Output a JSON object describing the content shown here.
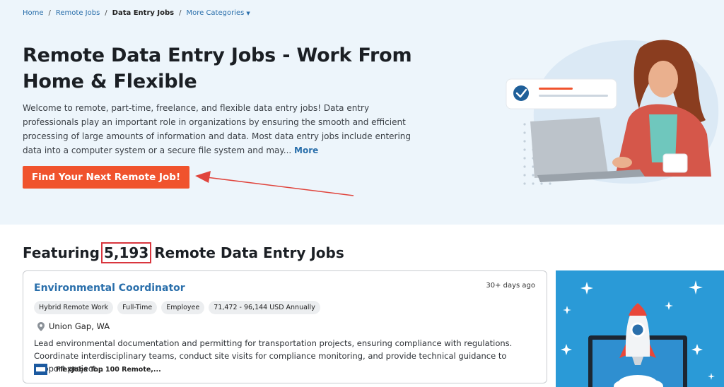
{
  "breadcrumb": {
    "home": "Home",
    "remote_jobs": "Remote Jobs",
    "current": "Data Entry Jobs",
    "more": "More Categories",
    "sep": "/"
  },
  "hero": {
    "title_line1": "Remote Data Entry Jobs - Work From",
    "title_line2": "Home & Flexible",
    "description": "Welcome to remote, part-time, freelance, and flexible data entry jobs! Data entry professionals play an important role in organizations by ensuring the smooth and efficient processing of large amounts of information and data. Most data entry jobs include entering data into a computer system or a secure file system and may...",
    "more_label": "More",
    "cta_label": "Find Your Next Remote Job!"
  },
  "featuring": {
    "prefix": "Featuring",
    "count": "5,193",
    "suffix": "Remote Data Entry Jobs"
  },
  "job": {
    "title": "Environmental Coordinator",
    "age": "30+ days ago",
    "tags": [
      "Hybrid Remote Work",
      "Full-Time",
      "Employee",
      "71,472 - 96,144 USD Annually"
    ],
    "location": "Union Gap, WA",
    "description": "Lead environmental documentation and permitting for transportation projects, ensuring compliance with regulations. Coordinate interdisciplinary teams, conduct site visits for compliance monitoring, and provide technical guidance to support project...",
    "company": "FlexJobs Top 100 Remote,..."
  },
  "colors": {
    "hero_bg": "#edf5fb",
    "accent_orange": "#f0532d",
    "link_blue": "#2a6fab",
    "highlight_red": "#d9363e",
    "ad_blue": "#2a9ad7"
  },
  "icons": {
    "caret": "caret-down-icon",
    "location": "location-pin-icon",
    "check": "check-circle-icon"
  }
}
